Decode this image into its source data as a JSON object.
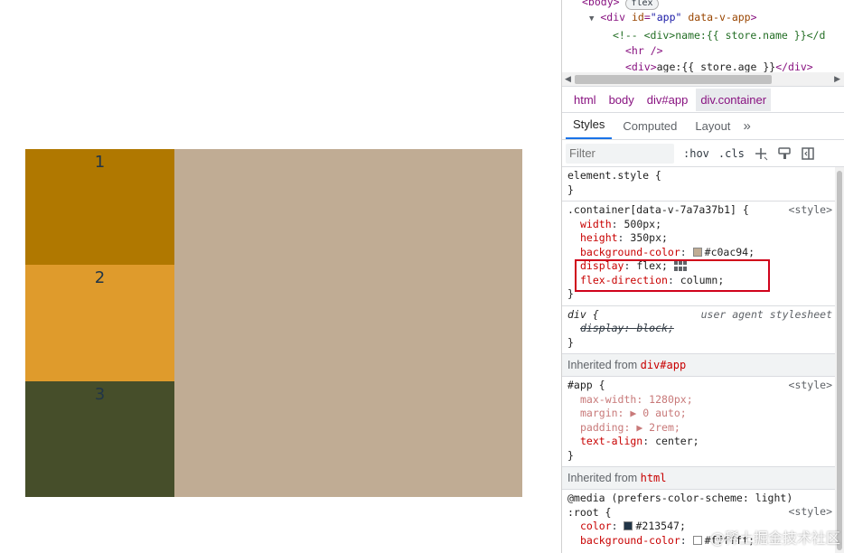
{
  "page": {
    "boxes": [
      {
        "label": "1",
        "color": "#b07800"
      },
      {
        "label": "2",
        "color": "#df9b2c"
      },
      {
        "label": "3",
        "color": "#464e2a"
      }
    ],
    "container_bg": "#c0ac94"
  },
  "devtools": {
    "elements": {
      "line0_tag": "<body>",
      "line0_badge": "flex",
      "line1_open": "<div",
      "line1_attr1_name": "id",
      "line1_attr1_val": "\"app\"",
      "line1_attr2_name": "data-v-app",
      "line1_close": ">",
      "line2_comment": "<!-- <div>name:{{ store.name }}</d",
      "line3": "<hr />",
      "line4_open": "<div>",
      "line4_text": "age:{{ store.age }}",
      "line4_close": "</div>"
    },
    "breadcrumb": [
      "html",
      "body",
      "div#app",
      "div.container"
    ],
    "tabs": [
      "Styles",
      "Computed",
      "Layout"
    ],
    "tab_more": "»",
    "filter_placeholder": "Filter",
    "filter_buttons": [
      ":hov",
      ".cls"
    ],
    "rules": {
      "element_style": {
        "selector": "element.style {",
        "close": "}"
      },
      "container": {
        "selector": ".container[data-v-7a7a37b1] {",
        "source": "<style>",
        "props": [
          {
            "name": "width",
            "value": "500px;"
          },
          {
            "name": "height",
            "value": "350px;"
          },
          {
            "name": "background-color",
            "value": "#c0ac94;"
          },
          {
            "name": "display",
            "value": "flex;"
          },
          {
            "name": "flex-direction",
            "value": "column;"
          }
        ],
        "close": "}"
      },
      "div_ua": {
        "selector": "div {",
        "source": "user agent stylesheet",
        "props": [
          {
            "name": "display",
            "value": "block;"
          }
        ],
        "close": "}"
      },
      "inherited_app": {
        "label": "Inherited from",
        "ref": "div#app"
      },
      "app": {
        "selector": "#app {",
        "source": "<style>",
        "props": [
          {
            "name": "max-width",
            "value": "1280px;"
          },
          {
            "name": "margin",
            "value": "0 auto;"
          },
          {
            "name": "padding",
            "value": "2rem;"
          },
          {
            "name": "text-align",
            "value": "center;"
          }
        ],
        "close": "}"
      },
      "inherited_html": {
        "label": "Inherited from",
        "ref": "html"
      },
      "root": {
        "media": "@media (prefers-color-scheme: light)",
        "selector": ":root {",
        "source": "<style>",
        "props": [
          {
            "name": "color",
            "value": "#213547;"
          },
          {
            "name": "background-color",
            "value": "#ffffff;"
          }
        ]
      }
    },
    "colors": {
      "swatch_bg": "#c0ac94",
      "swatch_text": "#213547",
      "swatch_white": "#ffffff",
      "highlight": "#d0021b",
      "accent": "#1a73e8"
    }
  },
  "watermark": "@稀土掘金技术社区"
}
